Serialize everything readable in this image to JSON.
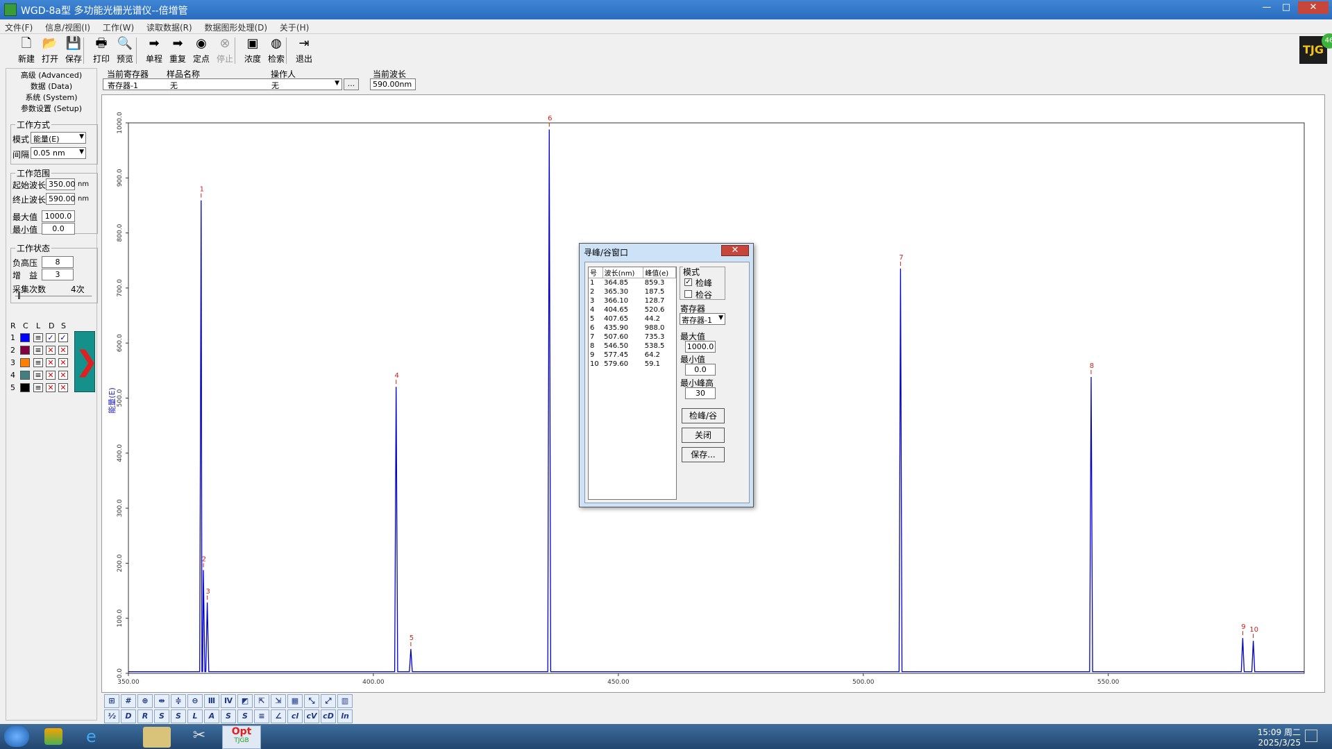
{
  "window": {
    "title": "WGD-8a型 多功能光栅光谱仪--倍增管",
    "minimize": "—",
    "maximize": "□",
    "close": "✕"
  },
  "menu": [
    "文件(F)",
    "信息/视图(I)",
    "工作(W)",
    "读取数据(R)",
    "数据图形处理(D)",
    "关于(H)"
  ],
  "toolbar": [
    {
      "label": "新建",
      "icon": "new-doc-icon",
      "glyph": "🗋"
    },
    {
      "label": "打开",
      "icon": "open-folder-icon",
      "glyph": "📂"
    },
    {
      "label": "保存",
      "icon": "save-icon",
      "glyph": "💾"
    },
    {
      "label": "打印",
      "icon": "print-icon",
      "glyph": "🖶"
    },
    {
      "label": "预览",
      "icon": "preview-icon",
      "glyph": "🔍"
    },
    {
      "label": "单程",
      "icon": "arrow-right-icon",
      "glyph": "➡"
    },
    {
      "label": "重复",
      "icon": "repeat-arrow-icon",
      "glyph": "➡"
    },
    {
      "label": "定点",
      "icon": "fixed-point-icon",
      "glyph": "◉"
    },
    {
      "label": "停止",
      "icon": "stop-icon",
      "glyph": "⊗"
    },
    {
      "label": "浓度",
      "icon": "concentration-icon",
      "glyph": "▣"
    },
    {
      "label": "检索",
      "icon": "globe-search-icon",
      "glyph": "◍"
    },
    {
      "label": "退出",
      "icon": "exit-icon",
      "glyph": "⇥"
    }
  ],
  "logo": {
    "text": "TJG",
    "badge": "46"
  },
  "left": {
    "tabs": [
      "高级 (Advanced)",
      "数据 (Data)",
      "系统 (System)",
      "参数设置 (Setup)"
    ],
    "work_mode": {
      "title": "工作方式",
      "mode_label": "模式",
      "mode_value": "能量(E)",
      "interval_label": "间隔",
      "interval_value": "0.05 nm"
    },
    "range": {
      "title": "工作范围",
      "start_label": "起始波长",
      "start_value": "350.00",
      "end_label": "终止波长",
      "end_value": "590.00",
      "unit": "nm",
      "max_label": "最大值",
      "max_value": "1000.0",
      "min_label": "最小值",
      "min_value": "0.0"
    },
    "status": {
      "title": "工作状态",
      "hv_label": "负高压",
      "hv_value": "8",
      "gain_label": "增　益",
      "gain_value": "3",
      "count_label": "采集次数",
      "count_value": "4次"
    },
    "legend_headers": [
      "R",
      "C",
      "L",
      "D",
      "S"
    ],
    "legend": [
      {
        "num": "1",
        "color": "#0000ff"
      },
      {
        "num": "2",
        "color": "#800040"
      },
      {
        "num": "3",
        "color": "#ff8000"
      },
      {
        "num": "4",
        "color": "#408080"
      },
      {
        "num": "5",
        "color": "#000000"
      }
    ]
  },
  "header": {
    "reg_label": "当前寄存器",
    "reg_value": "寄存器-1",
    "sample_label": "样品名称",
    "sample_value": "无",
    "operator_label": "操作人",
    "operator_value": "无",
    "browse": "...",
    "wl_label": "当前波长",
    "wl_value": "590.00nm"
  },
  "chart_data": {
    "type": "line",
    "ylabel": "能量(E)",
    "xlim": [
      350,
      590
    ],
    "ylim": [
      0,
      1000
    ],
    "x_ticks": [
      "350.00",
      "400.00",
      "450.00",
      "500.00",
      "550.00"
    ],
    "y_ticks": [
      "0.0",
      "100.0",
      "200.0",
      "300.0",
      "400.0",
      "500.0",
      "600.0",
      "700.0",
      "800.0",
      "900.0",
      "1000.0"
    ],
    "peaks": [
      {
        "label": "1",
        "x": 364.85,
        "y": 859.3
      },
      {
        "label": "2",
        "x": 365.3,
        "y": 187.5
      },
      {
        "label": "3",
        "x": 366.1,
        "y": 128.7
      },
      {
        "label": "4",
        "x": 404.65,
        "y": 520.6
      },
      {
        "label": "5",
        "x": 407.65,
        "y": 44.2
      },
      {
        "label": "6",
        "x": 435.9,
        "y": 988.0
      },
      {
        "label": "7",
        "x": 507.6,
        "y": 735.3
      },
      {
        "label": "8",
        "x": 546.5,
        "y": 538.5
      },
      {
        "label": "9",
        "x": 577.45,
        "y": 64.2
      },
      {
        "label": "10",
        "x": 579.6,
        "y": 59.1
      }
    ]
  },
  "dialog": {
    "title": "寻峰/谷窗口",
    "close": "✕",
    "columns": [
      "号",
      "波长(nm)",
      "峰值(e)"
    ],
    "rows": [
      [
        "1",
        "364.85",
        "859.3"
      ],
      [
        "2",
        "365.30",
        "187.5"
      ],
      [
        "3",
        "366.10",
        "128.7"
      ],
      [
        "4",
        "404.65",
        "520.6"
      ],
      [
        "5",
        "407.65",
        "44.2"
      ],
      [
        "6",
        "435.90",
        "988.0"
      ],
      [
        "7",
        "507.60",
        "735.3"
      ],
      [
        "8",
        "546.50",
        "538.5"
      ],
      [
        "9",
        "577.45",
        "64.2"
      ],
      [
        "10",
        "579.60",
        "59.1"
      ]
    ],
    "mode_title": "模式",
    "peak_label": "检峰",
    "valley_label": "检谷",
    "register_title": "寄存器",
    "register_value": "寄存器-1",
    "max_label": "最大值",
    "max_value": "1000.0",
    "min_label": "最小值",
    "min_value": "0.0",
    "minpeak_label": "最小峰高",
    "minpeak_value": "30",
    "btn_detect": "检峰/谷",
    "btn_close": "关闭",
    "btn_save": "保存..."
  },
  "taskbar": {
    "time": "15:09 周二",
    "date": "2025/3/25",
    "opt_app": "Opt",
    "opt_sub": "TJGB"
  }
}
